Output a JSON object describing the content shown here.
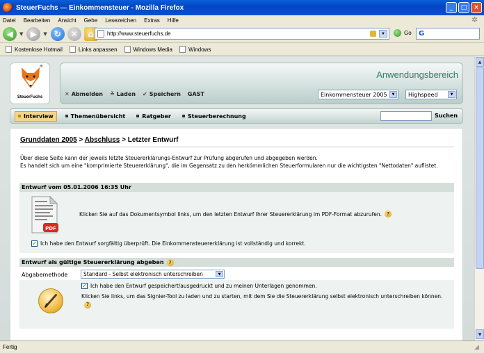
{
  "window": {
    "title": "SteuerFuchs — Einkommensteuer - Mozilla Firefox",
    "min_label": "_",
    "max_label": "□",
    "close_label": "×"
  },
  "menu": [
    "Datei",
    "Bearbeiten",
    "Ansicht",
    "Gehe",
    "Lesezeichen",
    "Extras",
    "Hilfe"
  ],
  "nav": {
    "url": "http://www.steuerfuchs.de",
    "go_label": "Go",
    "search_logo": "G"
  },
  "bookmarks": [
    "Kostenlose Hotmail",
    "Links anpassen",
    "Windows Media",
    "Windows"
  ],
  "site": {
    "brand": "SteuerFuchs",
    "registered": "®",
    "area_title": "Anwendungsbereich",
    "actions": {
      "logout": "Abmelden",
      "load": "Laden",
      "save": "Speichern",
      "user": "GAST"
    },
    "tax_select": "Einkommensteuer 2005",
    "speed_select": "Highspeed",
    "tabs": [
      "Interview",
      "Themenübersicht",
      "Ratgeber",
      "Steuerberechnung"
    ],
    "search_label": "Suchen"
  },
  "main": {
    "breadcrumb": {
      "part1": "Grunddaten 2005",
      "sep1": " > ",
      "part2": "Abschluss",
      "sep2": " > ",
      "current": "Letzter Entwurf"
    },
    "intro_line1": "Über diese Seite kann der jeweils letzte Steuererklärungs-Entwurf zur Prüfung abgerufen und abgegeben werden.",
    "intro_line2": "Es handelt sich um eine \"komprimierte Steuererklärung\", die im Gegensatz zu den herkömmlichen Steuerformularen nur die wichtigsten \"Nettodaten\" auflistet.",
    "draft_section": {
      "title": "Entwurf vom 05.01.2006 16:35 Uhr",
      "pdf_badge": "PDF",
      "pdf_text": "Klicken Sie auf das Dokumentsymbol links, um den letzten Entwurf Ihrer Steuererklärung im PDF-Format abzurufen.",
      "check_label": "Ich habe den Entwurf sorgfältig überprüft. Die Einkommensteuererklärung ist vollständig und korrekt.",
      "checked": true
    },
    "submit_section": {
      "title": "Entwurf als gültige Steuererklärung abgeben",
      "method_label": "Abgabemethode",
      "method_value": "Standard - Selbst elektronisch unterschreiben",
      "check_label": "Ich habe den Entwurf gespeichert/ausgedruckt und zu meinen Unterlagen genommen.",
      "checked": true,
      "sign_text": "Klicken Sie links, um das Signier-Tool zu laden und zu starten, mit dem Sie die Steuererklärung selbst elektronisch unterschreiben können."
    },
    "help_glyph": "?",
    "check_glyph": "✓"
  },
  "status": {
    "text": "Fertig"
  }
}
